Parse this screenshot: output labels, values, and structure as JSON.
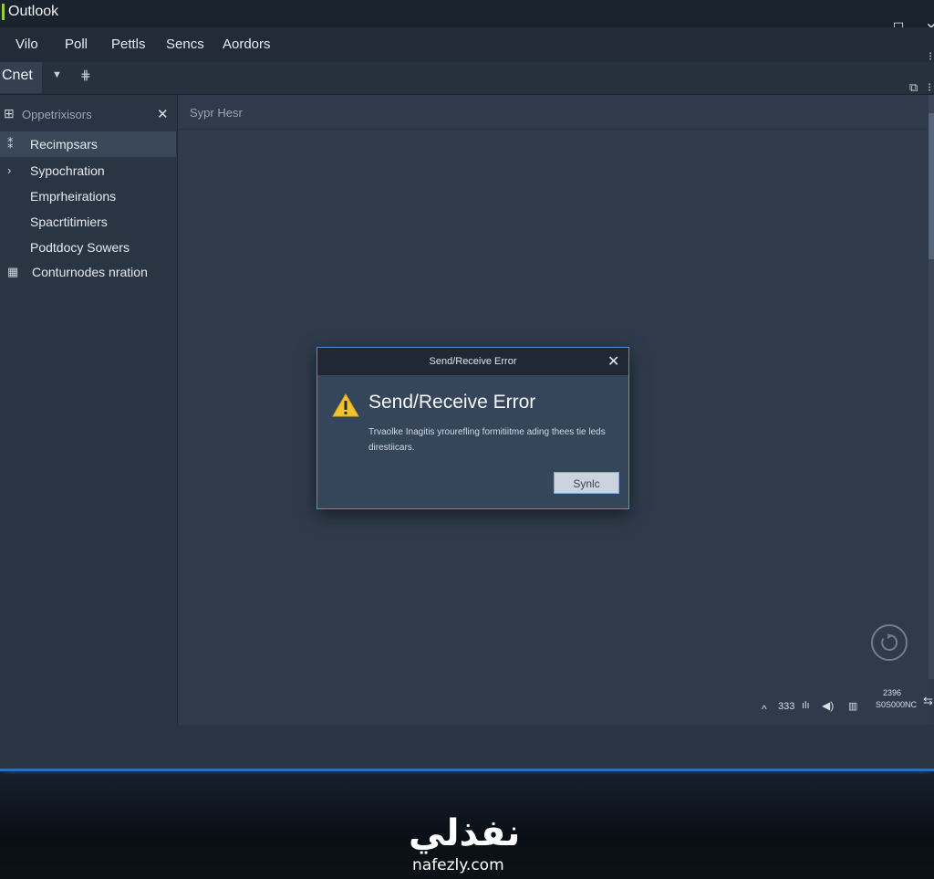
{
  "window": {
    "title": "Outlook",
    "controls": {
      "minimize": "—",
      "maximize": "☐",
      "close": "✕"
    }
  },
  "menu": [
    "Vilo",
    "Poll",
    "Pettls",
    "Sencs",
    "Aordors"
  ],
  "toolbar": {
    "label": "Cnet",
    "dropdown_icon": "chevron-down-icon",
    "settings_icon": "sliders-icon"
  },
  "sidebar": {
    "header": "Oppetrixisors",
    "items": [
      {
        "label": "Recimpsars",
        "icon": "pin-icon",
        "selected": true
      },
      {
        "label": "Sypochration",
        "icon": "chevron-right-icon",
        "selected": false
      },
      {
        "label": "Emprheirations",
        "icon": "",
        "selected": false
      },
      {
        "label": "Spacrtitimiers",
        "icon": "",
        "selected": false
      },
      {
        "label": "Podtdocy Sowers",
        "icon": "",
        "selected": false
      },
      {
        "label": "Conturnodes nration",
        "icon": "grid-icon",
        "selected": false
      }
    ]
  },
  "main": {
    "header": "Sypr Hesr"
  },
  "dialog": {
    "title": "Send/Receive Error",
    "heading": "Send/Receive Error",
    "message": "Trvaolke Inagitis yrourefling formitiitme ading thees tie leds direstiicars.",
    "button": "Synlc",
    "icon": "warning-icon",
    "warning_color": "#f2c230"
  },
  "statusbar": {
    "caret": "^",
    "count": "333",
    "line1": "2396",
    "line2": "S0S000NC"
  },
  "watermark": {
    "arabic": "نفذلي",
    "latin": "nafezly.com"
  },
  "colors": {
    "accent": "#2a6fb8",
    "dialog_border": "#5b8ccc"
  }
}
